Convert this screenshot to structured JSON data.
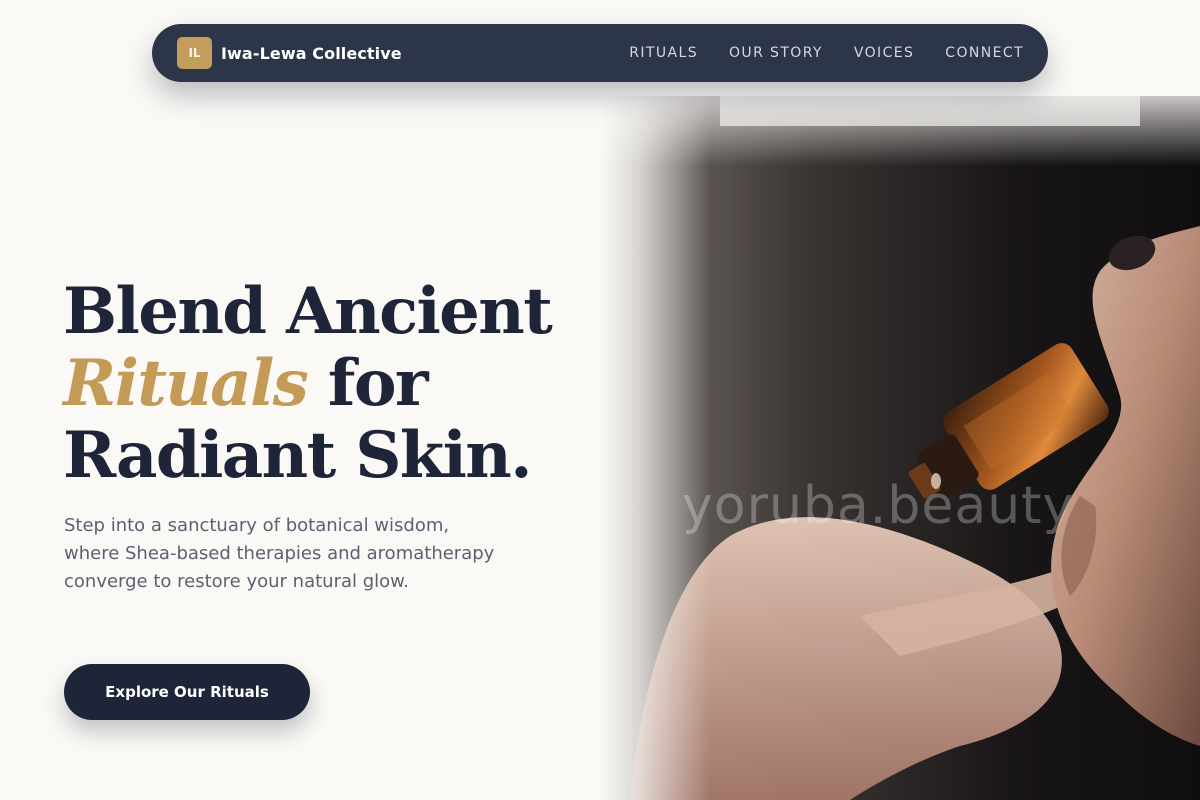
{
  "brand": {
    "badge": "IL",
    "name": "Iwa-Lewa Collective"
  },
  "nav": {
    "links": [
      {
        "label": "RITUALS"
      },
      {
        "label": "OUR STORY"
      },
      {
        "label": "VOICES"
      },
      {
        "label": "CONNECT"
      }
    ]
  },
  "hero": {
    "headline": {
      "line1": "Blend Ancient",
      "accent": "Rituals",
      "line2_rest": " for",
      "line3": "Radiant Skin."
    },
    "subtext": "Step into a sanctuary of botanical wisdom, where Shea-based therapies and aromatherapy converge to restore your natural glow.",
    "cta_label": "Explore Our Rituals",
    "image_watermark": "yoruba.beauty"
  },
  "colors": {
    "navy": "#1e2539",
    "nav_bg": "#2d3648",
    "gold": "#c39b57",
    "page_bg": "#faf9f6"
  }
}
